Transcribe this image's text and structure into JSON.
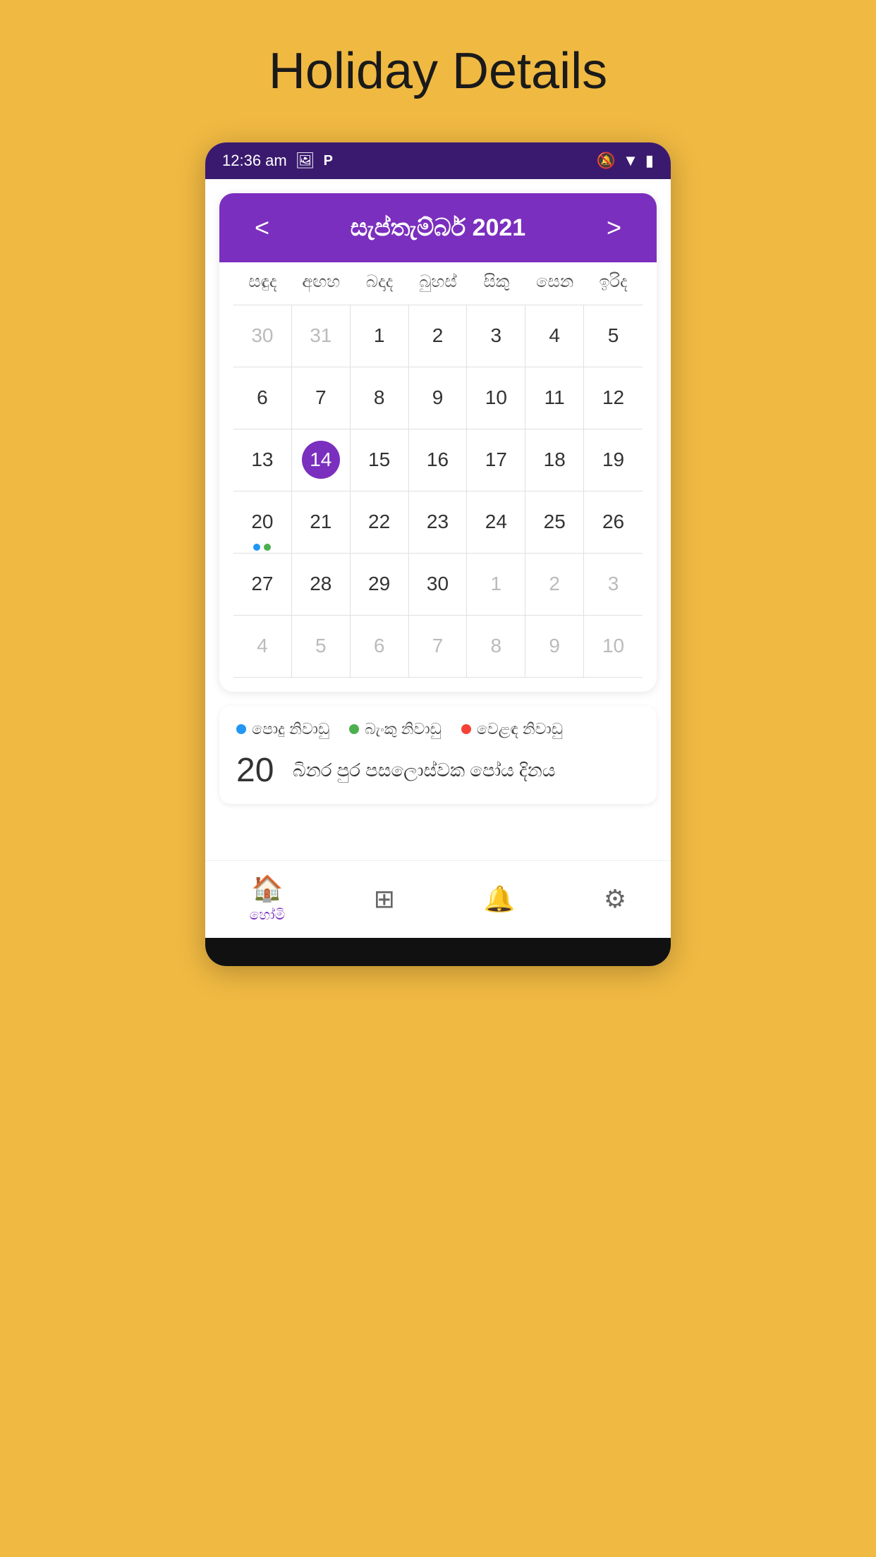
{
  "page": {
    "title": "Holiday Details",
    "background": "#F0B942"
  },
  "statusBar": {
    "time": "12:36 am",
    "icons": [
      "image",
      "parking",
      "bell-mute",
      "wifi",
      "battery"
    ]
  },
  "calendar": {
    "prevBtn": "<",
    "nextBtn": ">",
    "monthTitle": "සැප්තැම්බර් 2021",
    "dayHeaders": [
      "සඳුද",
      "අඟහ",
      "බදාද",
      "බුහස්",
      "සිකු",
      "සෙන",
      "ඉරිද"
    ],
    "weeks": [
      [
        {
          "day": "30",
          "muted": true
        },
        {
          "day": "31",
          "muted": true
        },
        {
          "day": "1"
        },
        {
          "day": "2"
        },
        {
          "day": "3"
        },
        {
          "day": "4"
        },
        {
          "day": "5"
        }
      ],
      [
        {
          "day": "6"
        },
        {
          "day": "7"
        },
        {
          "day": "8"
        },
        {
          "day": "9"
        },
        {
          "day": "10"
        },
        {
          "day": "11"
        },
        {
          "day": "12"
        }
      ],
      [
        {
          "day": "13"
        },
        {
          "day": "14",
          "today": true
        },
        {
          "day": "15"
        },
        {
          "day": "16"
        },
        {
          "day": "17"
        },
        {
          "day": "18"
        },
        {
          "day": "19"
        }
      ],
      [
        {
          "day": "20",
          "dots": [
            "blue",
            "green"
          ]
        },
        {
          "day": "21"
        },
        {
          "day": "22"
        },
        {
          "day": "23"
        },
        {
          "day": "24"
        },
        {
          "day": "25"
        },
        {
          "day": "26"
        }
      ],
      [
        {
          "day": "27"
        },
        {
          "day": "28"
        },
        {
          "day": "29"
        },
        {
          "day": "30"
        },
        {
          "day": "1",
          "muted": true
        },
        {
          "day": "2",
          "muted": true
        },
        {
          "day": "3",
          "muted": true
        }
      ],
      [
        {
          "day": "4",
          "muted": true
        },
        {
          "day": "5",
          "muted": true
        },
        {
          "day": "6",
          "muted": true
        },
        {
          "day": "7",
          "muted": true
        },
        {
          "day": "8",
          "muted": true
        },
        {
          "day": "9",
          "muted": true
        },
        {
          "day": "10",
          "muted": true
        }
      ]
    ]
  },
  "legend": {
    "items": [
      {
        "color": "#2196F3",
        "label": "පොදු නිවාඩු"
      },
      {
        "color": "#4CAF50",
        "label": "බැංකු නිවාඩු"
      },
      {
        "color": "#F44336",
        "label": "වෙළඳ නිවාඩු"
      }
    ]
  },
  "holidayEntry": {
    "date": "20",
    "name": "බිනර පුර පසලොස්වක පෝය දිනය"
  },
  "bottomNav": {
    "items": [
      {
        "icon": "🏠",
        "label": "හෝමි",
        "active": true
      },
      {
        "icon": "⊞",
        "label": "",
        "active": false
      },
      {
        "icon": "🔔",
        "label": "",
        "active": false
      },
      {
        "icon": "⚙",
        "label": "",
        "active": false
      }
    ]
  }
}
